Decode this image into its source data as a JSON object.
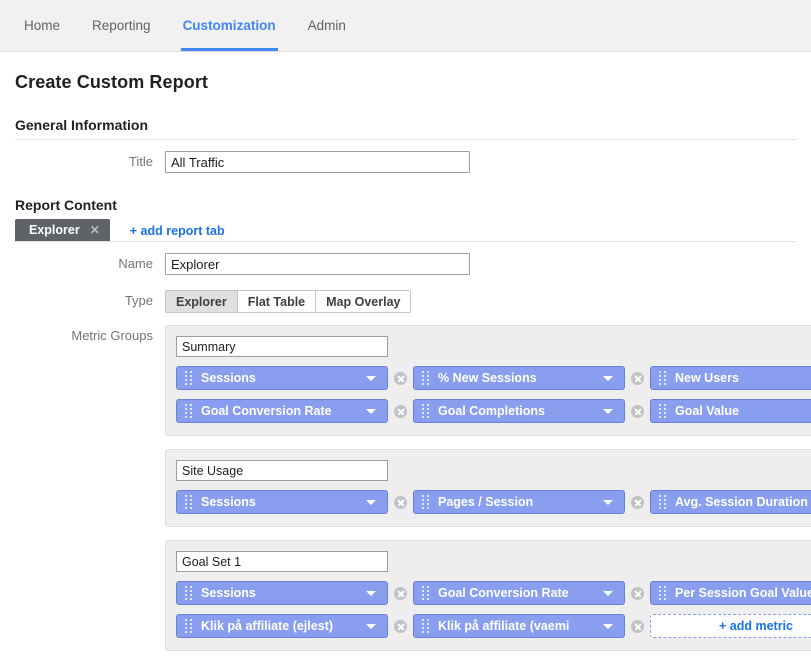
{
  "nav": {
    "items": [
      {
        "label": "Home",
        "active": false
      },
      {
        "label": "Reporting",
        "active": false
      },
      {
        "label": "Customization",
        "active": true
      },
      {
        "label": "Admin",
        "active": false
      }
    ],
    "accent_color": "#4285f4"
  },
  "page": {
    "title": "Create Custom Report"
  },
  "general_information": {
    "heading": "General Information",
    "title_label": "Title",
    "title_value": "All Traffic",
    "title_placeholder": ""
  },
  "report_content": {
    "heading": "Report Content",
    "tab": {
      "label": "Explorer",
      "close_glyph": "✕"
    },
    "add_tab_label": "+ add report tab",
    "name_label": "Name",
    "name_value": "Explorer",
    "type_label": "Type",
    "types": [
      {
        "label": "Explorer",
        "selected": true
      },
      {
        "label": "Flat Table",
        "selected": false
      },
      {
        "label": "Map Overlay",
        "selected": false
      }
    ],
    "metric_groups_label": "Metric Groups",
    "add_metric_label": "+ add metric",
    "metric_groups": [
      {
        "name": "Summary",
        "rows": [
          [
            {
              "label": "Sessions",
              "caret": true,
              "removable": true
            },
            {
              "label": "% New Sessions",
              "caret": true,
              "removable": true
            },
            {
              "label": "New Users",
              "caret": true,
              "removable": true
            }
          ],
          [
            {
              "label": "Goal Conversion Rate",
              "caret": true,
              "removable": true
            },
            {
              "label": "Goal Completions",
              "caret": true,
              "removable": true
            },
            {
              "label": "Goal Value",
              "caret": true,
              "removable": true
            }
          ]
        ]
      },
      {
        "name": "Site Usage",
        "rows": [
          [
            {
              "label": "Sessions",
              "caret": true,
              "removable": true
            },
            {
              "label": "Pages / Session",
              "caret": true,
              "removable": true
            },
            {
              "label": "Avg. Session Duration",
              "caret": true,
              "removable": true
            }
          ]
        ]
      },
      {
        "name": "Goal Set 1",
        "rows": [
          [
            {
              "label": "Sessions",
              "caret": true,
              "removable": true
            },
            {
              "label": "Goal Conversion Rate",
              "caret": true,
              "removable": true
            },
            {
              "label": "Per Session Goal Value",
              "caret": true,
              "removable": true
            }
          ],
          [
            {
              "label": "Klik på affiliate (ejlest)",
              "caret": true,
              "removable": true
            },
            {
              "label": "Klik på affiliate (vaemi",
              "caret": true,
              "removable": true
            },
            {
              "label": "+ add metric",
              "add": true
            }
          ]
        ]
      }
    ]
  },
  "colors": {
    "pill_fill": "#8a9ef0",
    "pill_border": "#6b7fd4",
    "link": "#1a73e8",
    "tab_bg": "#5f6368",
    "group_bg": "#eeeeee"
  }
}
